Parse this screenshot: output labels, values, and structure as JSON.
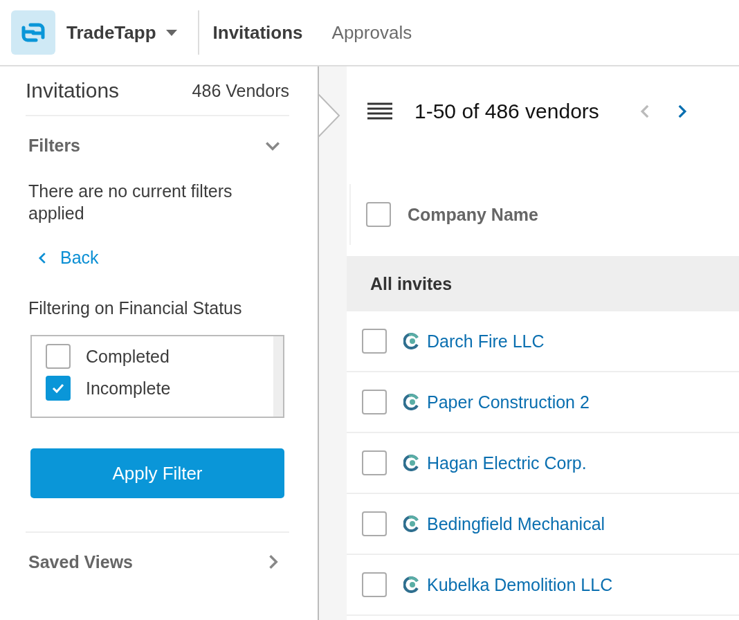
{
  "app": {
    "name": "TradeTapp"
  },
  "nav_tabs": [
    {
      "label": "Invitations",
      "selected": true
    },
    {
      "label": "Approvals",
      "selected": false
    }
  ],
  "sidebar": {
    "title": "Invitations",
    "count": "486 Vendors",
    "filters": {
      "label": "Filters",
      "expanded": true,
      "message": "There are no current filters applied",
      "back": "Back",
      "heading": "Filtering on Financial Status",
      "options": [
        {
          "label": "Completed",
          "checked": false
        },
        {
          "label": "Incomplete",
          "checked": true
        }
      ],
      "apply_button": "Apply Filter"
    },
    "saved_views": {
      "label": "Saved Views"
    }
  },
  "list": {
    "range": "1-50 of 486 vendors",
    "prev_disabled": true,
    "next_disabled": false,
    "column": "Company Name",
    "select_all_checked": false,
    "group": "All invites",
    "rows": [
      {
        "name": "Darch Fire LLC",
        "checked": false
      },
      {
        "name": "Paper Construction 2",
        "checked": false
      },
      {
        "name": "Hagan Electric Corp.",
        "checked": false
      },
      {
        "name": "Bedingfield Mechanical",
        "checked": false
      },
      {
        "name": "Kubelka Demolition LLC",
        "checked": false
      }
    ]
  }
}
